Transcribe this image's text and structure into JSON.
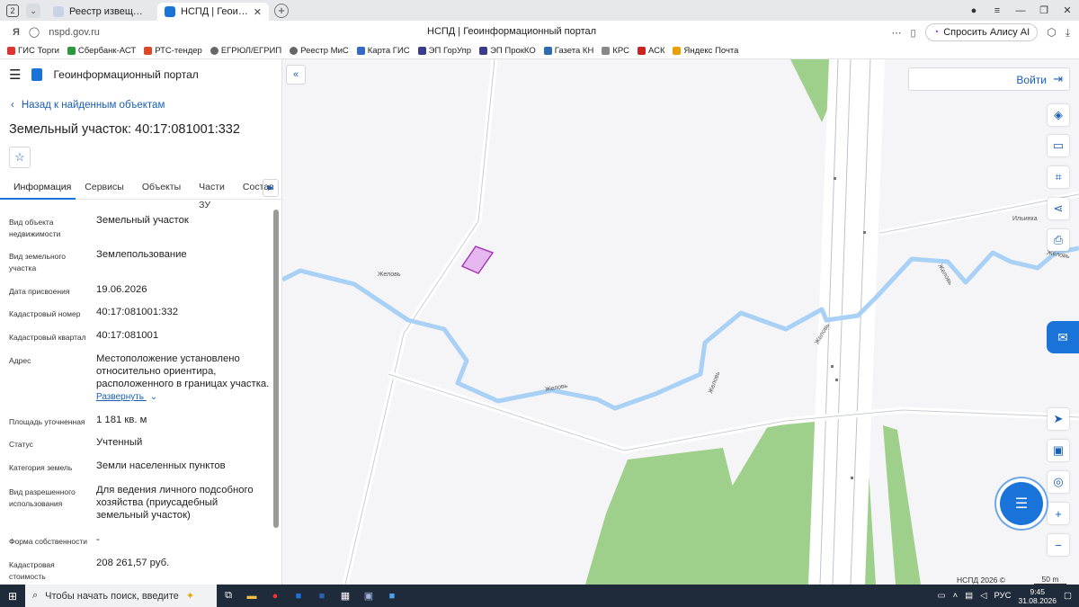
{
  "browser": {
    "tab_count": "2",
    "tabs": [
      {
        "title": "Реестр извещений",
        "active": false
      },
      {
        "title": "НСПД | Геоинформационный портал",
        "active": true
      }
    ],
    "new_tab_label": "+",
    "url": "nspd.gov.ru",
    "page_title": "НСПД | Геоинформационный портал",
    "alisa_label": "Спросить Алису AI",
    "bookmarks": [
      "ГИС Торги",
      "Сбербанк-АСТ",
      "РТС-тендер",
      "ЕГРЮЛ/ЕГРИП",
      "Реестр МиС",
      "Карта ГИС",
      "ЭП ГорУпр",
      "ЭП ПрокКО",
      "Газета КН",
      "КРС",
      "АСК",
      "Яндекс Почта"
    ]
  },
  "panel": {
    "portal_title": "Геоинформационный портал",
    "back_label": "Назад к найденным объектам",
    "object_title": "Земельный участок: 40:17:081001:332",
    "tabs": [
      "Информация",
      "Сервисы",
      "Объекты",
      "Части ЗУ",
      "Состав"
    ],
    "fields": [
      {
        "label": "Вид объекта недвижимости",
        "value": "Земельный участок"
      },
      {
        "label": "Вид земельного участка",
        "value": "Землепользование"
      },
      {
        "label": "Дата присвоения",
        "value": "19.06.2026"
      },
      {
        "label": "Кадастровый номер",
        "value": "40:17:081001:332"
      },
      {
        "label": "Кадастровый квартал",
        "value": "40:17:081001"
      },
      {
        "label": "Адрес",
        "value": "Местоположение установлено относительно ориентира, расположенного в границах участка."
      },
      {
        "label": "Площадь уточненная",
        "value": "1 181 кв. м"
      },
      {
        "label": "Статус",
        "value": "Учтенный"
      },
      {
        "label": "Категория земель",
        "value": "Земли населенных пунктов"
      },
      {
        "label": "Вид разрешенного использования",
        "value": "Для ведения личного подсобного хозяйства (приусадебный земельный участок)"
      },
      {
        "label": "Форма собственности",
        "value": "-"
      },
      {
        "label": "Кадастровая стоимость",
        "value": "208 261,57 руб."
      }
    ],
    "expand_label": "Развернуть"
  },
  "map": {
    "login_label": "Войти",
    "copyright": "НСПД 2026 ©",
    "scale": "50 m",
    "labels": {
      "village_left": "Желовь",
      "village_right": "Ильинка",
      "river_1": "Желовь",
      "river_2": "Желовь",
      "river_3": "Желовь",
      "river_4": "Желовь",
      "river_5": "Желовь"
    },
    "colors": {
      "river": "#a9d1f5",
      "forest": "#9fd08b",
      "parcel_fill": "#e6b8ef",
      "parcel_stroke": "#a43ab3",
      "accent": "#1a73d9"
    }
  },
  "taskbar": {
    "search_placeholder": "Чтобы начать поиск, введите",
    "lang": "РУС",
    "time": "9:45",
    "date": "31.08.2026"
  }
}
